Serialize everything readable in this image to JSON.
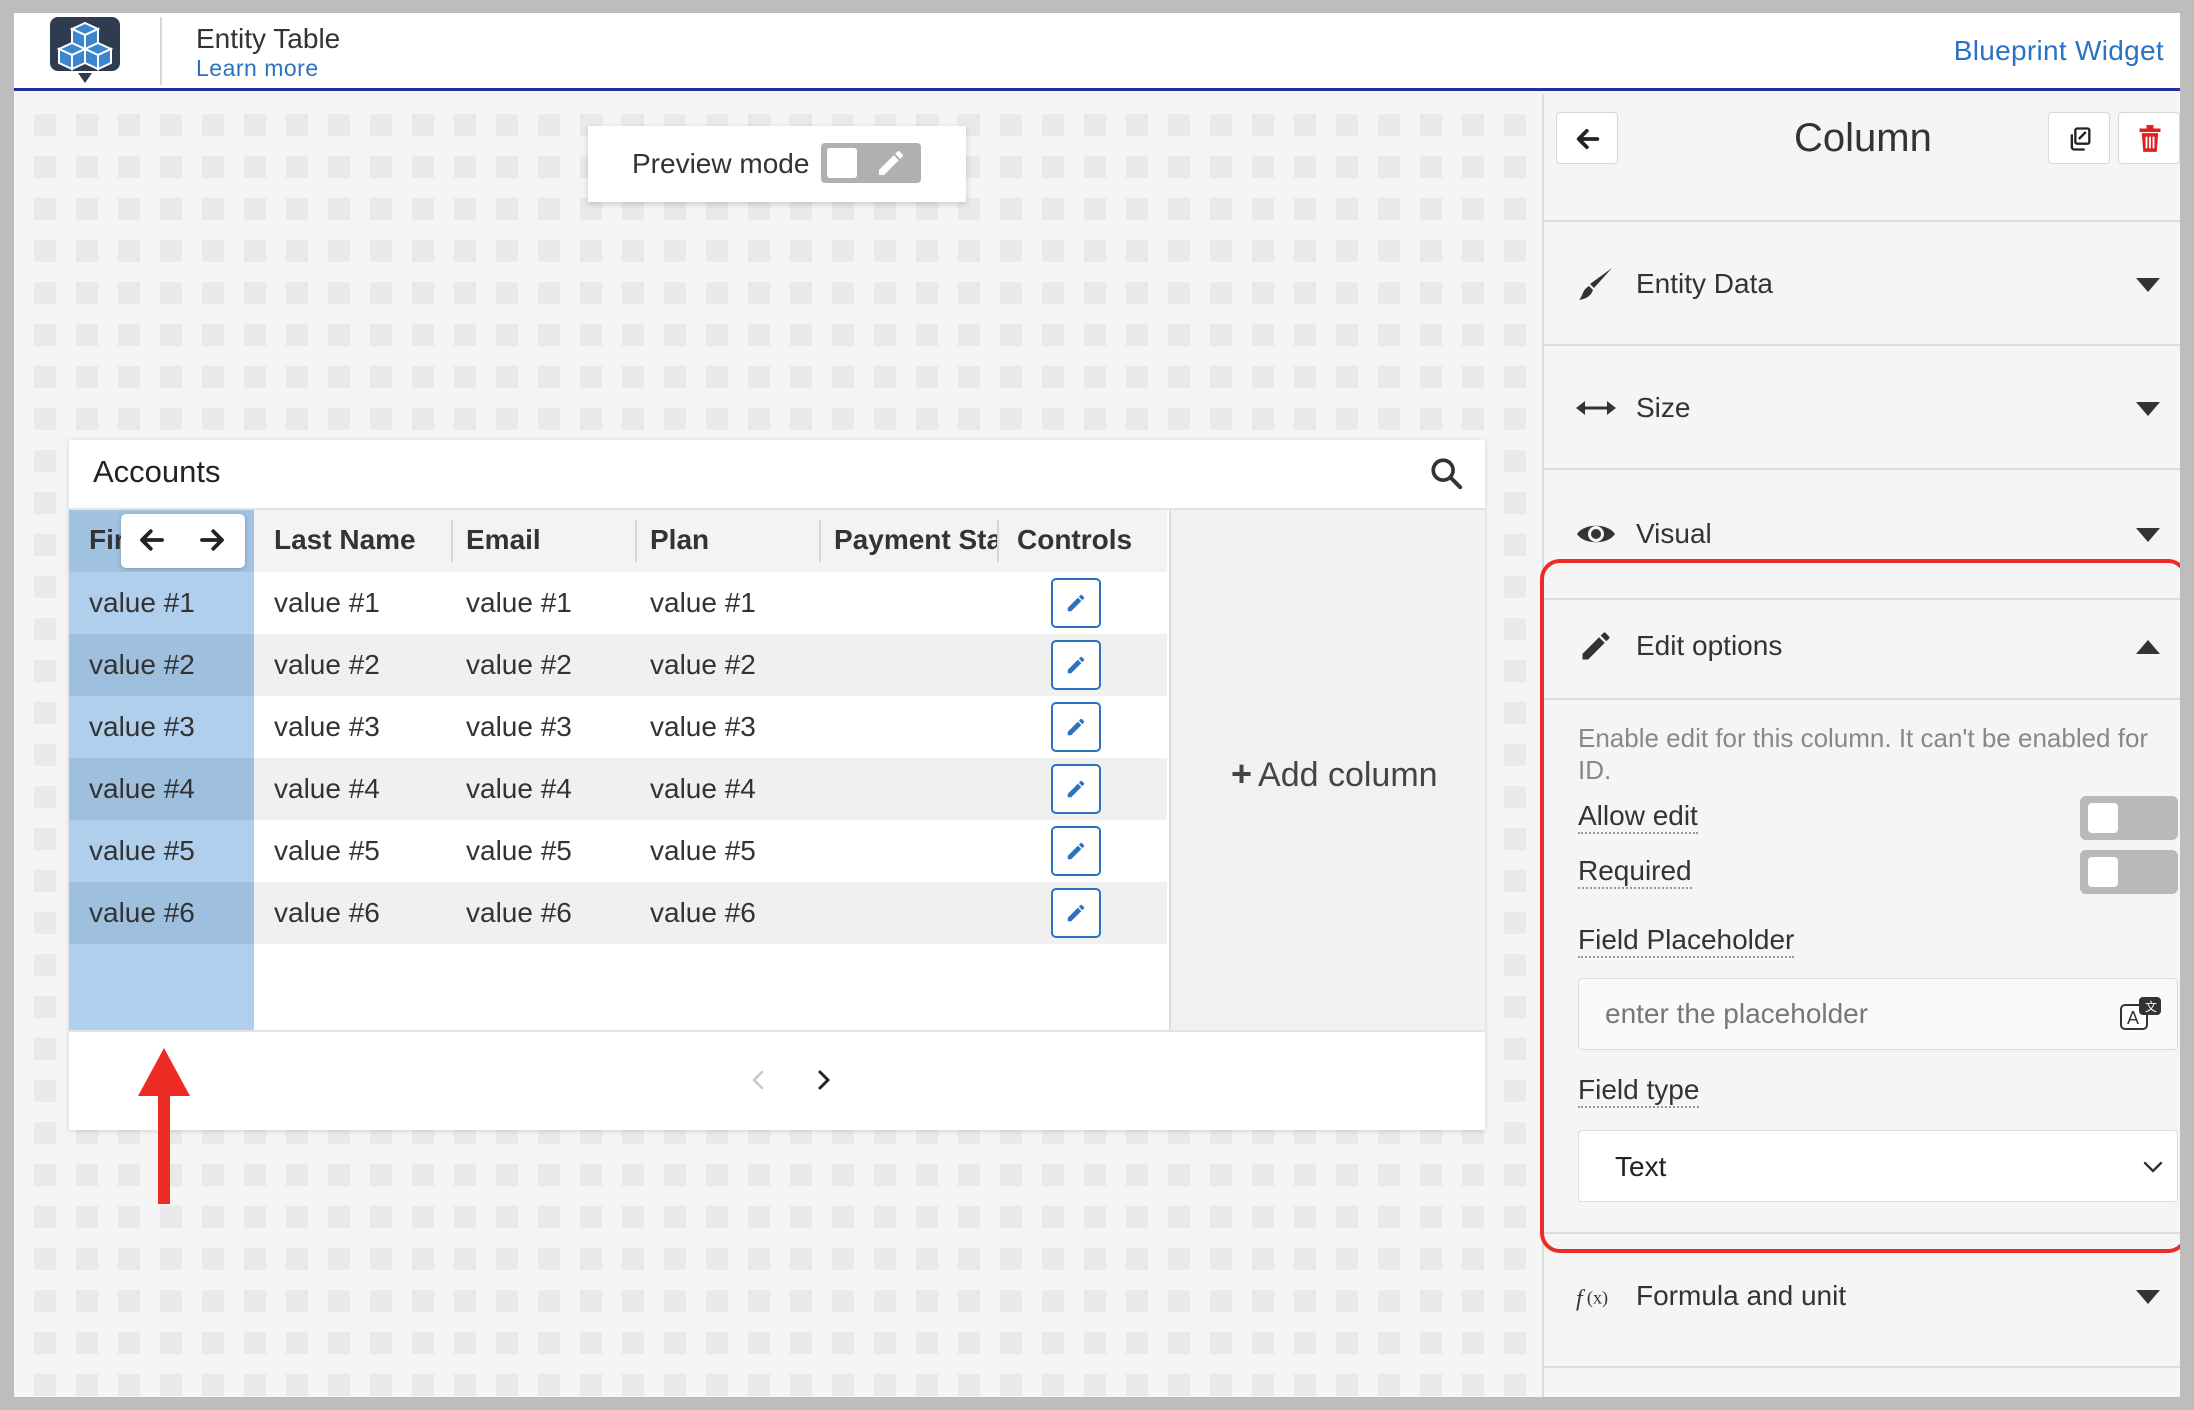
{
  "header": {
    "title": "Entity Table",
    "learn_more": "Learn more",
    "brand": "Blueprint Widget",
    "accent_color": "#24309a",
    "link_color": "#2a73c3"
  },
  "preview": {
    "label": "Preview mode",
    "enabled": false
  },
  "table": {
    "title": "Accounts",
    "columns": [
      "Fir",
      "Last Name",
      "Email",
      "Plan",
      "Payment Sta",
      "Controls"
    ],
    "rows": [
      [
        "value #1",
        "value #1",
        "value #1",
        "value #1",
        ""
      ],
      [
        "value #2",
        "value #2",
        "value #2",
        "value #2",
        ""
      ],
      [
        "value #3",
        "value #3",
        "value #3",
        "value #3",
        ""
      ],
      [
        "value #4",
        "value #4",
        "value #4",
        "value #4",
        ""
      ],
      [
        "value #5",
        "value #5",
        "value #5",
        "value #5",
        ""
      ],
      [
        "value #6",
        "value #6",
        "value #6",
        "value #6",
        ""
      ]
    ],
    "add_column_label": "Add column",
    "selected_column_color": "#b0cfec"
  },
  "panel": {
    "title": "Column",
    "sections": {
      "entity_data": "Entity Data",
      "size": "Size",
      "visual": "Visual",
      "edit_options": "Edit options",
      "formula": "Formula and unit"
    },
    "edit": {
      "description": "Enable edit for this column. It can't be enabled for ID.",
      "allow_edit_label": "Allow edit",
      "allow_edit": false,
      "required_label": "Required",
      "required": false,
      "placeholder_label": "Field Placeholder",
      "placeholder_value": "",
      "placeholder_hint": "enter the placeholder",
      "field_type_label": "Field type",
      "field_type_value": "Text"
    }
  },
  "icons": {
    "logo": "cubes-logo-icon",
    "search": "search-icon",
    "pencil": "pencil-icon",
    "back": "arrow-left-icon",
    "copy": "copy-icon",
    "delete": "trash-icon",
    "brush": "brush-icon",
    "size": "horizontal-arrows-icon",
    "visual": "eye-icon",
    "formula": "function-icon",
    "translate": "translate-icon"
  },
  "highlight_color": "#ee2a24"
}
